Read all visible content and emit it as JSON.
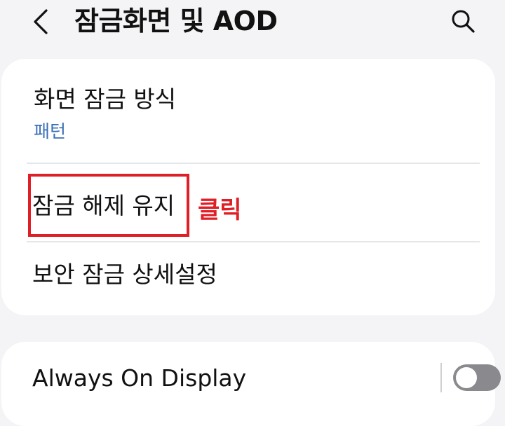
{
  "header": {
    "title": "잠금화면 및 AOD",
    "back_icon": "chevron-left-icon",
    "search_icon": "search-icon"
  },
  "lock_card": {
    "items": [
      {
        "title": "화면 잠금 방식",
        "subtitle": "패턴"
      },
      {
        "title": "잠금 해제 유지"
      },
      {
        "title": "보안 잠금 상세설정"
      }
    ]
  },
  "annotation": {
    "label": "클릭",
    "color": "#e01e25"
  },
  "aod_card": {
    "title": "Always On Display",
    "toggle_state": "off"
  },
  "colors": {
    "background": "#f4f4f7",
    "card": "#ffffff",
    "accent_blue": "#3b6fb6",
    "toggle_off": "#8a8a8e"
  }
}
